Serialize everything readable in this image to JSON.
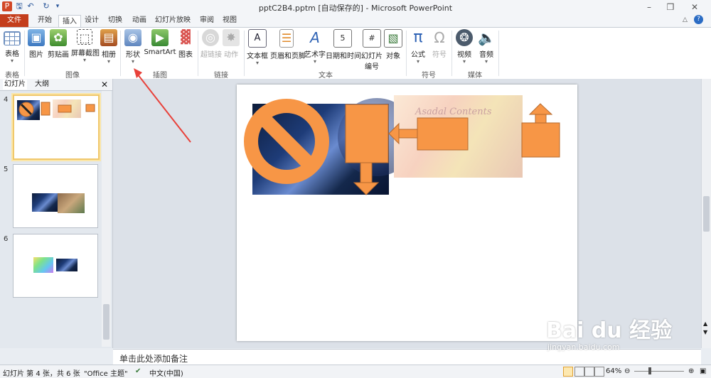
{
  "window": {
    "title": "pptC2B4.pptm [自动保存的] - Microsoft PowerPoint"
  },
  "tabs": [
    "文件",
    "开始",
    "插入",
    "设计",
    "切换",
    "动画",
    "幻灯片放映",
    "审阅",
    "视图"
  ],
  "ribbon": {
    "groups": {
      "tables": "表格",
      "images": "图像",
      "illustrations": "插图",
      "links": "链接",
      "text": "文本",
      "symbols": "符号",
      "media": "媒体"
    },
    "buttons": {
      "table": "表格",
      "picture": "图片",
      "clipart": "剪贴画",
      "screenshot": "屏幕截图",
      "album": "相册",
      "shapes": "形状",
      "smartart": "SmartArt",
      "chart": "图表",
      "hyperlink": "超链接",
      "action": "动作",
      "textbox": "文本框",
      "header_footer": "页眉和页脚",
      "wordart": "艺术字",
      "datetime": "日期和时间",
      "slide_number_1": "幻灯片",
      "slide_number_2": "编号",
      "object": "对象",
      "equation": "公式",
      "symbol": "符号",
      "video": "视频",
      "audio": "音频"
    }
  },
  "pane": {
    "tab_slides": "幻灯片",
    "tab_outline": "大纲",
    "slide_numbers": [
      "4",
      "5",
      "6"
    ]
  },
  "slide": {
    "watermark_text": "Asadal Contents"
  },
  "notes": {
    "placeholder": "单击此处添加备注"
  },
  "status": {
    "slide_info": "幻灯片 第 4 张，共 6 张",
    "theme": "\"Office 主题\"",
    "language": "中文(中国)",
    "zoom": "64%"
  },
  "watermark": {
    "brand": "Bai du 经验",
    "url": "jingyan.baidu.com"
  },
  "colors": {
    "accent_orange": "#f79646",
    "file_tab": "#c43e1c",
    "annotation_arrow": "#e8413a"
  }
}
